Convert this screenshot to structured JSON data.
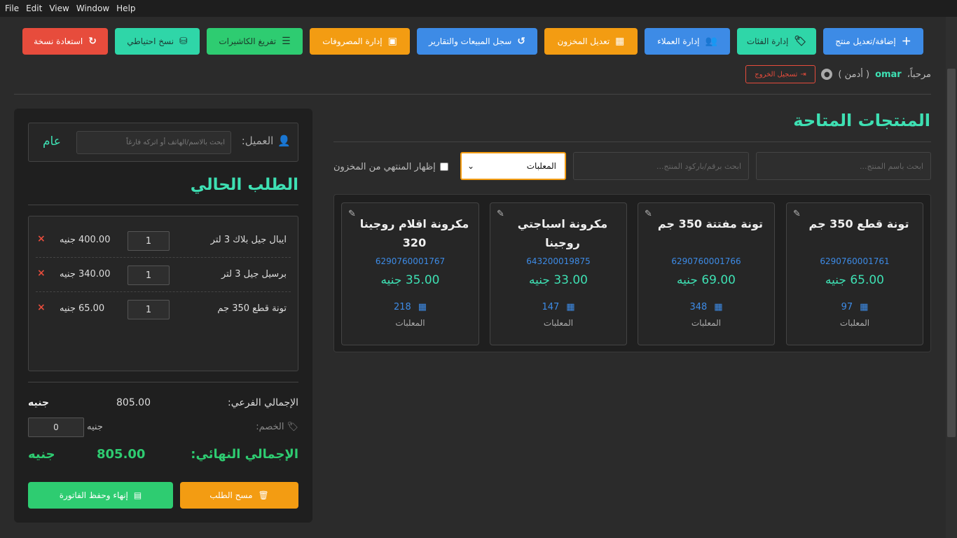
{
  "menu": [
    "File",
    "Edit",
    "View",
    "Window",
    "Help"
  ],
  "toolbar": {
    "add_product": "إضافة/تعديل منتج",
    "categories": "إدارة الفئات",
    "customers": "إدارة العملاء",
    "edit_stock": "تعديل المخزون",
    "sales_log": "سجل المبيعات والتقارير",
    "expenses": "إدارة المصروفات",
    "cashiers": "تفريغ الكاشيرات",
    "backup": "نسخ احتياطي",
    "restore": "استعادة نسخة"
  },
  "user": {
    "greeting": "مرحباً،",
    "name": "omar",
    "role": "( أدمن )",
    "logout": "تسجيل الخروج"
  },
  "order_panel": {
    "customer_label": "العميل:",
    "customer_placeholder": "ابحث بالاسم/الهاتف أو اتركه فارغاً",
    "customer_value": "عام",
    "title": "الطلب الحالي",
    "items": [
      {
        "name": "ايبال جيل بلاك 3 لتر",
        "qty": "1",
        "price": "400.00 جنيه",
        "remove": "×"
      },
      {
        "name": "برسيل جيل 3 لتر",
        "qty": "1",
        "price": "340.00 جنيه",
        "remove": "×"
      },
      {
        "name": "تونة قطع 350 جم",
        "qty": "1",
        "price": "65.00 جنيه",
        "remove": "×"
      }
    ],
    "subtotal_label": "الإجمالي الفرعي:",
    "subtotal_value": "805.00",
    "currency": "جنيه",
    "discount_label": "الخصم:",
    "discount_value": "0",
    "discount_currency": "جنيه",
    "total_label": "الإجمالي النهائي:",
    "total_value": "805.00",
    "total_currency": "جنيه",
    "clear_button": "مسح الطلب",
    "finish_button": "إنهاء وحفظ الفاتورة"
  },
  "products_panel": {
    "title": "المنتجات المتاحة",
    "search_name_placeholder": "ابحث باسم المنتج...",
    "search_code_placeholder": "ابحث برقم/باركود المنتج...",
    "category_selected": "المعلبات",
    "show_out_of_stock": "إظهار المنتهي من المخزون",
    "products": [
      {
        "name": "تونة قطع 350 جم",
        "code": "6290760001761",
        "price": "65.00 جنيه",
        "stock": "97",
        "category": "المعلبات"
      },
      {
        "name": "تونة مفتتة 350 جم",
        "code": "6290760001766",
        "price": "69.00 جنيه",
        "stock": "348",
        "category": "المعلبات"
      },
      {
        "name": "مكرونة اسباجتي روجينا",
        "code": "643200019875",
        "price": "33.00 جنيه",
        "stock": "147",
        "category": "المعلبات"
      },
      {
        "name": "مكرونة اقلام روجينا 320",
        "code": "6290760001767",
        "price": "35.00 جنيه",
        "stock": "218",
        "category": "المعلبات"
      }
    ]
  },
  "colors": {
    "accent": "#3ee0b3",
    "primary": "#3d8be6",
    "warning": "#f39c12",
    "success": "#2ecc71",
    "danger": "#e74c3c"
  }
}
